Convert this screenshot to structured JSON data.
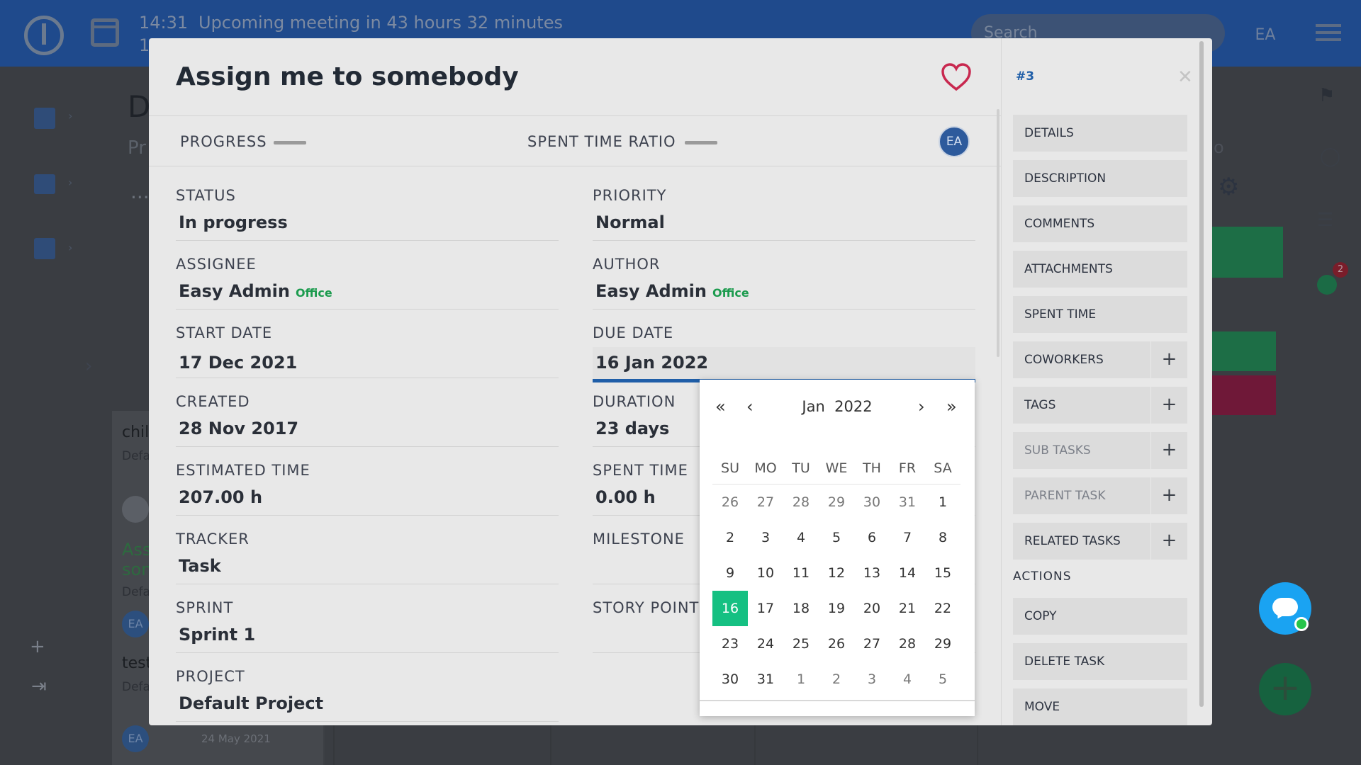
{
  "topbar": {
    "time": "14:31",
    "time_line2": "1",
    "message": "Upcoming meeting in 43 hours 32 minutes",
    "search_placeholder": "Search",
    "avatar": "EA"
  },
  "background": {
    "title_partial": "D",
    "subtitle_partial": "Pr",
    "dots": "...",
    "card1_title": "chil",
    "card1_sub": "Defa",
    "card2_title_line1": "Ass",
    "card2_title_line2": "son",
    "card2_sub": "Defa",
    "card3_title": "test",
    "card3_sub": "Defa",
    "avatar": "EA",
    "date": "24 May 2021",
    "right_partial_letter": "o",
    "badge_count": "2"
  },
  "modal": {
    "title": "Assign me to somebody",
    "header": {
      "progress_label": "PROGRESS",
      "spent_ratio_label": "SPENT TIME RATIO",
      "avatar": "EA"
    },
    "fields_left": [
      {
        "label": "STATUS",
        "value": "In progress"
      },
      {
        "label": "ASSIGNEE",
        "value": "Easy Admin",
        "tag": "Office"
      },
      {
        "label": "START DATE",
        "value": "17 Dec 2021"
      },
      {
        "label": "CREATED",
        "value": "28 Nov 2017"
      },
      {
        "label": "ESTIMATED TIME",
        "value": "207.00 h"
      },
      {
        "label": "TRACKER",
        "value": "Task"
      },
      {
        "label": "SPRINT",
        "value": "Sprint 1"
      },
      {
        "label": "PROJECT",
        "value": "Default Project"
      }
    ],
    "fields_right": [
      {
        "label": "PRIORITY",
        "value": "Normal"
      },
      {
        "label": "AUTHOR",
        "value": "Easy Admin",
        "tag": "Office"
      },
      {
        "label": "DUE DATE",
        "value": "16 Jan 2022"
      },
      {
        "label": "DURATION",
        "value": "23 days"
      },
      {
        "label": "SPENT TIME",
        "value": "0.00 h"
      },
      {
        "label": "MILESTONE",
        "value": ""
      },
      {
        "label": "STORY POINTS",
        "value": ""
      }
    ],
    "datepicker": {
      "month": "Jan",
      "year": "2022",
      "weekdays": [
        "SU",
        "MO",
        "TU",
        "WE",
        "TH",
        "FR",
        "SA"
      ],
      "weeks": [
        [
          "26",
          "27",
          "28",
          "29",
          "30",
          "31",
          "1"
        ],
        [
          "2",
          "3",
          "4",
          "5",
          "6",
          "7",
          "8"
        ],
        [
          "9",
          "10",
          "11",
          "12",
          "13",
          "14",
          "15"
        ],
        [
          "16",
          "17",
          "18",
          "19",
          "20",
          "21",
          "22"
        ],
        [
          "23",
          "24",
          "25",
          "26",
          "27",
          "28",
          "29"
        ],
        [
          "30",
          "31",
          "1",
          "2",
          "3",
          "4",
          "5"
        ]
      ],
      "selected_day": "16"
    },
    "side": {
      "id": "#3",
      "menu": [
        {
          "label": "DETAILS",
          "plus": false,
          "muted": false
        },
        {
          "label": "DESCRIPTION",
          "plus": false,
          "muted": false
        },
        {
          "label": "COMMENTS",
          "plus": false,
          "muted": false
        },
        {
          "label": "ATTACHMENTS",
          "plus": false,
          "muted": false
        },
        {
          "label": "SPENT TIME",
          "plus": false,
          "muted": false
        },
        {
          "label": "COWORKERS",
          "plus": true,
          "muted": false
        },
        {
          "label": "TAGS",
          "plus": true,
          "muted": false
        },
        {
          "label": "SUB TASKS",
          "plus": true,
          "muted": true
        },
        {
          "label": "PARENT TASK",
          "plus": true,
          "muted": true
        },
        {
          "label": "RELATED TASKS",
          "plus": true,
          "muted": false
        }
      ],
      "actions_label": "ACTIONS",
      "actions": [
        {
          "label": "COPY"
        },
        {
          "label": "DELETE TASK"
        },
        {
          "label": "MOVE"
        }
      ]
    }
  },
  "colors": {
    "accent_blue": "#1f5ea8",
    "selected_green": "#15c082",
    "tag_green": "#1c9b4e",
    "heart_red": "#c8284f"
  },
  "icons": [
    "logo-icon",
    "calendar-icon",
    "menu-icon",
    "dashboard-icon",
    "tree-icon",
    "clipboard-icon",
    "add-user-icon",
    "logout-icon",
    "heart-icon",
    "close-icon",
    "gear-icon",
    "flag-icon",
    "lightbulb-icon",
    "checklist-icon",
    "chat-icon",
    "plus-icon"
  ]
}
